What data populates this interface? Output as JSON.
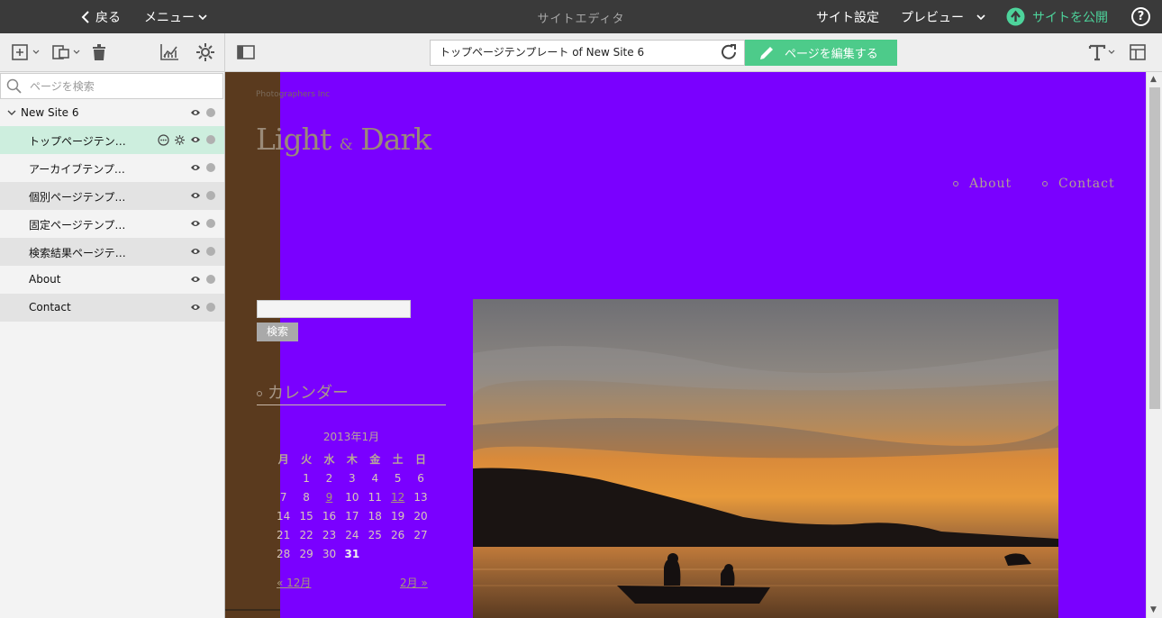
{
  "topbar": {
    "back_label": "戻る",
    "menu_label": "メニュー",
    "title": "サイトエディタ",
    "site_settings_label": "サイト設定",
    "preview_label": "プレビュー",
    "publish_label": "サイトを公開",
    "help_label": "?"
  },
  "toolbar": {
    "page_field_value": "トップページテンプレート of New Site 6",
    "edit_button_label": "ページを編集する",
    "icons": [
      "add-page-icon",
      "copy-page-icon",
      "trash-icon",
      "analytics-icon",
      "settings-icon",
      "sidebar-toggle-icon",
      "reload-icon",
      "text-format-icon",
      "layout-icon"
    ]
  },
  "sidebar": {
    "search_placeholder": "ページを検索",
    "site_name": "New Site 6",
    "pages": [
      {
        "label": "トップページテン…",
        "selected": true
      },
      {
        "label": "アーカイブテンプ…",
        "selected": false
      },
      {
        "label": "個別ページテンプ…",
        "selected": false
      },
      {
        "label": "固定ページテンプ…",
        "selected": false
      },
      {
        "label": "検索結果ページテ…",
        "selected": false
      },
      {
        "label": "About",
        "selected": false
      },
      {
        "label": "Contact",
        "selected": false
      }
    ]
  },
  "preview": {
    "company": "Photographers Inc",
    "logo_light": "Light",
    "logo_amp": "&",
    "logo_dark": "Dark",
    "nav": [
      "About",
      "Contact"
    ],
    "search_button": "検索",
    "calendar_heading": "カレンダー",
    "calendar_caption": "2013年1月",
    "weekdays": [
      "月",
      "火",
      "水",
      "木",
      "金",
      "土",
      "日"
    ],
    "weeks": [
      [
        "",
        "1",
        "2",
        "3",
        "4",
        "5",
        "6"
      ],
      [
        "7",
        "8",
        "9",
        "10",
        "11",
        "12",
        "13"
      ],
      [
        "14",
        "15",
        "16",
        "17",
        "18",
        "19",
        "20"
      ],
      [
        "21",
        "22",
        "23",
        "24",
        "25",
        "26",
        "27"
      ],
      [
        "28",
        "29",
        "30",
        "31",
        "",
        "",
        ""
      ]
    ],
    "linked_days": [
      "9",
      "12"
    ],
    "today": "31",
    "prev_month": "« 12月",
    "next_month": "2月 »"
  },
  "colors": {
    "accent_green": "#4dcb8a",
    "publish_green": "#4dd39b",
    "preview_bg": "#7a00ff",
    "selected_row": "#cdeede"
  }
}
